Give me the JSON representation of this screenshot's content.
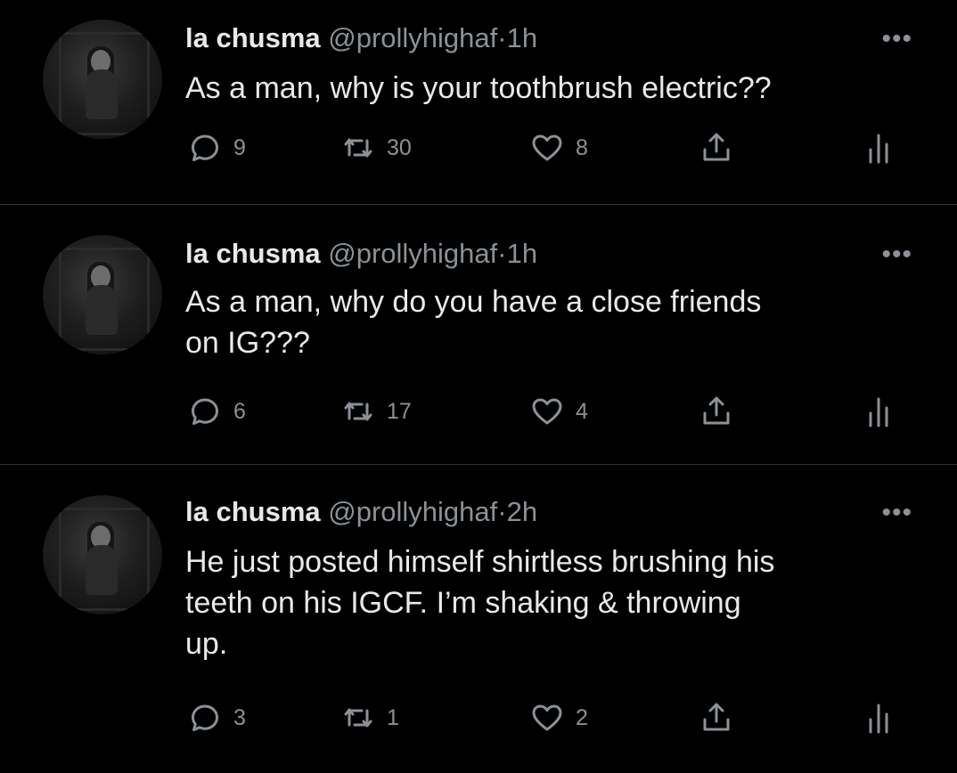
{
  "tweets": [
    {
      "name": "la chusma",
      "handle": "@prollyhighaf",
      "dot": "·",
      "time": "1h",
      "more": "•••",
      "lines": [
        "As a man, why is your toothbrush electric??"
      ],
      "replies": "9",
      "retweets": "30",
      "likes": "8"
    },
    {
      "name": "la chusma",
      "handle": "@prollyhighaf",
      "dot": "·",
      "time": "1h",
      "more": "•••",
      "lines": [
        "As a man, why do you have a close friends",
        "on IG???"
      ],
      "replies": "6",
      "retweets": "17",
      "likes": "4"
    },
    {
      "name": "la chusma",
      "handle": "@prollyhighaf",
      "dot": "·",
      "time": "2h",
      "more": "•••",
      "lines": [
        "He just posted himself shirtless brushing his",
        "teeth on his IGCF. I’m shaking & throwing",
        "up."
      ],
      "replies": "3",
      "retweets": "1",
      "likes": "2"
    }
  ],
  "icons": {
    "reply": "reply-icon",
    "retweet": "retweet-icon",
    "like": "heart-icon",
    "share": "share-icon",
    "analytics": "analytics-icon",
    "more": "more-options-icon"
  },
  "colors": {
    "background": "#000000",
    "text": "#e7e9ea",
    "secondary": "#8b9196",
    "divider": "#2f3336"
  }
}
